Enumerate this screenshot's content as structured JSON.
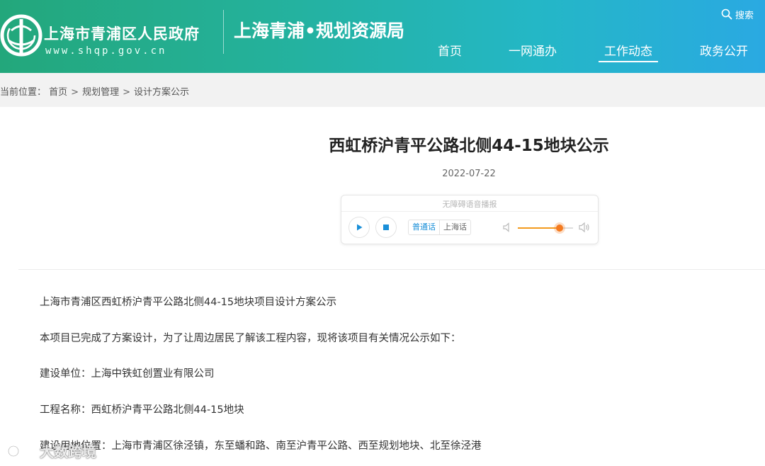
{
  "header": {
    "site_name": "上海市青浦区人民政府",
    "site_url": "www.shqp.gov.cn",
    "bureau_name": "上海青浦•规划资源局",
    "search_label": "搜索",
    "nav": [
      {
        "label": "首页"
      },
      {
        "label": "一网通办"
      },
      {
        "label": "工作动态",
        "active": true
      },
      {
        "label": "政务公开"
      }
    ]
  },
  "breadcrumb": {
    "prefix": "当前位置：",
    "items": [
      "首页",
      "规划管理",
      "设计方案公示"
    ],
    "separator": ">"
  },
  "article": {
    "title": "西虹桥沪青平公路北侧44-15地块公示",
    "date": "2022-07-22",
    "paragraphs": [
      "上海市青浦区西虹桥沪青平公路北侧44-15地块项目设计方案公示",
      "本项目已完成了方案设计，为了让周边居民了解该工程内容，现将该项目有关情况公示如下：",
      "建设单位：上海中铁虹创置业有限公司",
      "工程名称：西虹桥沪青平公路北侧44-15地块",
      "建设用地位置：上海市青浦区徐泾镇，东至蟠和路、南至沪青平公路、西至规划地块、北至徐泾港"
    ]
  },
  "player": {
    "label": "无障碍语音播报",
    "lang_mandarin": "普通话",
    "lang_shanghai": "上海话",
    "volume": 0.75
  },
  "watermark": {
    "text": "大数跨境"
  },
  "colors": {
    "header_start": "#23a77b",
    "header_end": "#2aa9e2",
    "accent_blue": "#1a8fd8",
    "slider_orange": "#f47a1f"
  }
}
